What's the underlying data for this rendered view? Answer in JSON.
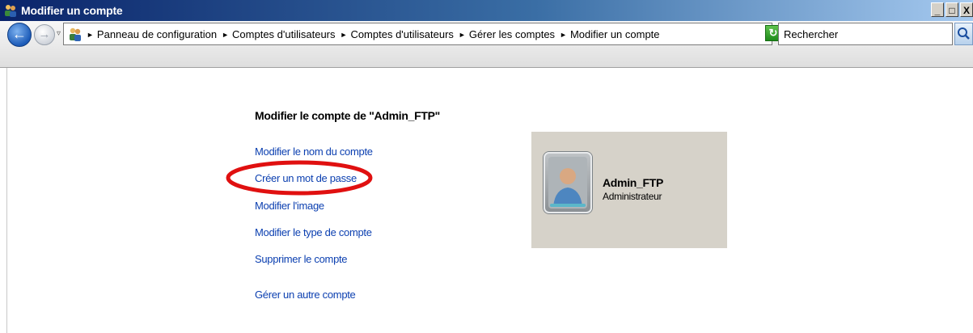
{
  "window": {
    "title": "Modifier un compte",
    "buttons": {
      "minimize": "_",
      "maximize": "□",
      "close": "X"
    }
  },
  "address_bar": {
    "breadcrumbs": [
      "Panneau de configuration",
      "Comptes d'utilisateurs",
      "Comptes d'utilisateurs",
      "Gérer les comptes",
      "Modifier un compte"
    ],
    "search_placeholder": "Rechercher"
  },
  "main": {
    "heading": "Modifier le compte de \"Admin_FTP\"",
    "tasks": [
      "Modifier le nom du compte",
      "Créer un mot de passe",
      "Modifier l'image",
      "Modifier le type de compte",
      "Supprimer le compte"
    ],
    "other_account_link": "Gérer un autre compte"
  },
  "user_card": {
    "name": "Admin_FTP",
    "role": "Administrateur"
  },
  "annotation": {
    "color": "#e01010",
    "target": "Créer un mot de passe"
  },
  "colors": {
    "link": "#0b3fb0",
    "card_bg": "#d6d2c9"
  },
  "icons": [
    "users-icon",
    "back-arrow-icon",
    "forward-arrow-icon",
    "refresh-icon",
    "search-icon",
    "user-avatar-icon"
  ]
}
